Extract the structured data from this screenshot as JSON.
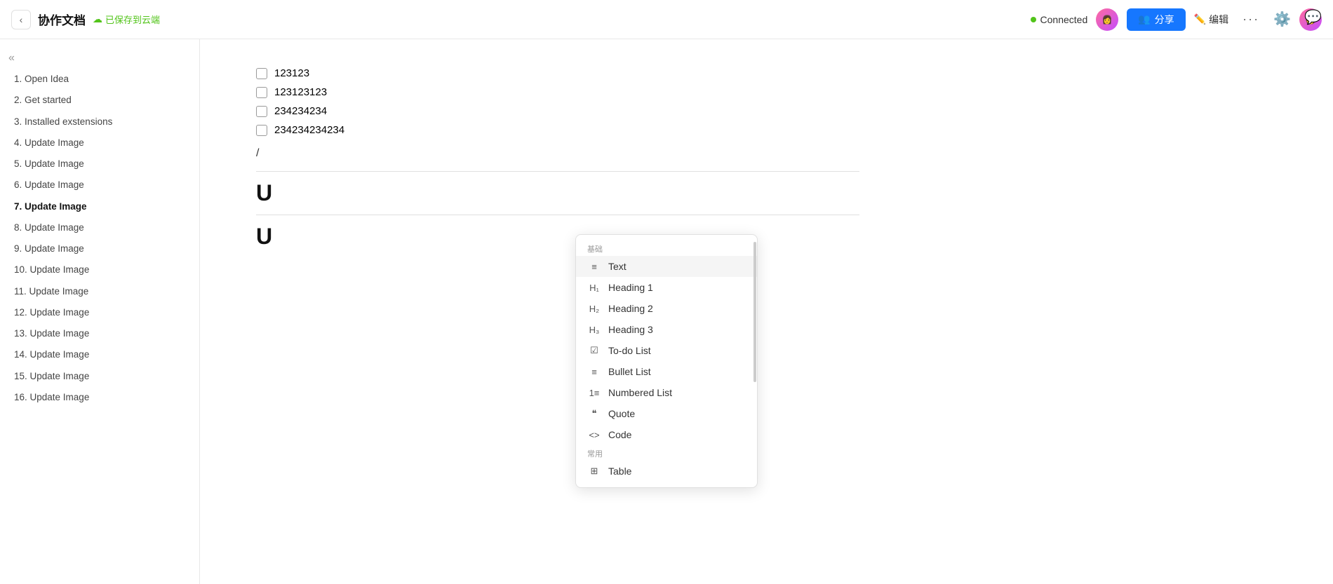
{
  "header": {
    "back_label": "‹",
    "title": "协作文档",
    "cloud_save_label": "已保存到云端",
    "connected_label": "Connected",
    "share_label": "分享",
    "edit_label": "编辑",
    "more_label": "···"
  },
  "sidebar": {
    "collapse_icon": "«",
    "items": [
      {
        "id": 1,
        "label": "1. Open Idea",
        "active": false
      },
      {
        "id": 2,
        "label": "2. Get started",
        "active": false
      },
      {
        "id": 3,
        "label": "3. Installed exstensions",
        "active": false
      },
      {
        "id": 4,
        "label": "4. Update Image",
        "active": false
      },
      {
        "id": 5,
        "label": "5. Update Image",
        "active": false
      },
      {
        "id": 6,
        "label": "6. Update Image",
        "active": false
      },
      {
        "id": 7,
        "label": "7. Update Image",
        "active": true
      },
      {
        "id": 8,
        "label": "8. Update Image",
        "active": false
      },
      {
        "id": 9,
        "label": "9. Update Image",
        "active": false
      },
      {
        "id": 10,
        "label": "10. Update Image",
        "active": false
      },
      {
        "id": 11,
        "label": "11. Update Image",
        "active": false
      },
      {
        "id": 12,
        "label": "12. Update Image",
        "active": false
      },
      {
        "id": 13,
        "label": "13. Update Image",
        "active": false
      },
      {
        "id": 14,
        "label": "14. Update Image",
        "active": false
      },
      {
        "id": 15,
        "label": "15. Update Image",
        "active": false
      },
      {
        "id": 16,
        "label": "16. Update Image",
        "active": false
      }
    ]
  },
  "editor": {
    "todo_items": [
      {
        "text": "123123"
      },
      {
        "text": "123123123"
      },
      {
        "text": "234234234"
      },
      {
        "text": "234234234234"
      }
    ],
    "slash_char": "/",
    "big_U_1": "U",
    "big_U_2": "U"
  },
  "dropdown": {
    "section_basic": "基础",
    "section_common": "常用",
    "items": [
      {
        "icon": "≡",
        "label": "Text",
        "selected": true
      },
      {
        "icon": "H₁",
        "label": "Heading 1",
        "selected": false
      },
      {
        "icon": "H₂",
        "label": "Heading 2",
        "selected": false
      },
      {
        "icon": "H₃",
        "label": "Heading 3",
        "selected": false
      },
      {
        "icon": "☑",
        "label": "To-do List",
        "selected": false
      },
      {
        "icon": "≡",
        "label": "Bullet List",
        "selected": false
      },
      {
        "icon": "1≡",
        "label": "Numbered List",
        "selected": false
      },
      {
        "icon": "❝",
        "label": "Quote",
        "selected": false
      },
      {
        "icon": "<>",
        "label": "Code",
        "selected": false
      }
    ],
    "common_item": "Table"
  }
}
